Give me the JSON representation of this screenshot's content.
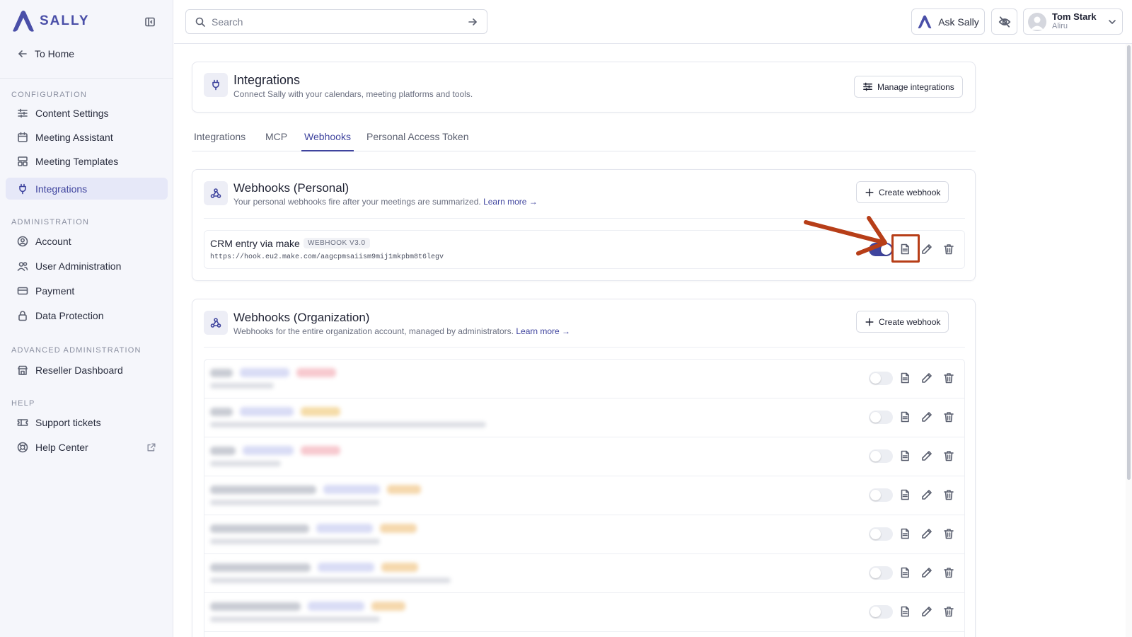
{
  "brand": {
    "name": "SALLY",
    "accent": "#4a4fa8"
  },
  "sidebar": {
    "to_home": "To Home",
    "sections": {
      "configuration": "CONFIGURATION",
      "administration": "ADMINISTRATION",
      "advanced": "ADVANCED ADMINISTRATION",
      "help": "HELP"
    },
    "items": {
      "content_settings": "Content Settings",
      "meeting_assistant": "Meeting Assistant",
      "meeting_templates": "Meeting Templates",
      "integrations": "Integrations",
      "account": "Account",
      "user_administration": "User Administration",
      "payment": "Payment",
      "data_protection": "Data Protection",
      "reseller_dashboard": "Reseller Dashboard",
      "support_tickets": "Support tickets",
      "help_center": "Help Center"
    }
  },
  "topbar": {
    "search_placeholder": "Search",
    "ask_label": "Ask Sally",
    "user_name": "Tom Stark",
    "user_org": "Aliru"
  },
  "page": {
    "title": "Integrations",
    "description": "Connect Sally with your calendars, meeting platforms and tools.",
    "manage_label": "Manage integrations",
    "tabs": [
      "Integrations",
      "MCP",
      "Webhooks",
      "Personal Access Token"
    ],
    "active_tab": "Webhooks"
  },
  "personal": {
    "title": "Webhooks (Personal)",
    "description": "Your personal webhooks fire after your meetings are summarized.",
    "learn_more": "Learn more →",
    "create_label": "Create webhook",
    "webhook": {
      "name": "CRM entry via make",
      "version": "WEBHOOK V3.0",
      "url": "https://hook.eu2.make.com/aagcpmsaiism9mij1mkpbm8t6legv",
      "enabled": true
    }
  },
  "organization": {
    "title": "Webhooks (Organization)",
    "description": "Webhooks for the entire organization account, managed by administrators.",
    "learn_more": "Learn more →",
    "create_label": "Create webhook"
  },
  "colors": {
    "annotation": "#b73e18",
    "toggle_on": "#3f449e"
  }
}
